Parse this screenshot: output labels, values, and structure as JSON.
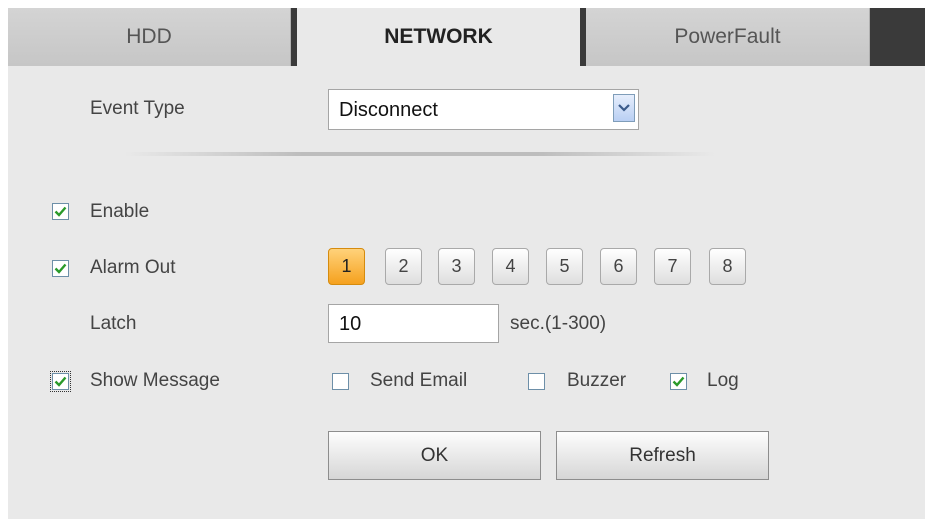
{
  "tabs": [
    {
      "label": "HDD",
      "active": false
    },
    {
      "label": "NETWORK",
      "active": true
    },
    {
      "label": "PowerFault",
      "active": false
    }
  ],
  "event_type": {
    "label": "Event Type",
    "value": "Disconnect"
  },
  "enable": {
    "label": "Enable",
    "checked": true
  },
  "alarm_out": {
    "label": "Alarm Out",
    "checked": true,
    "channels": [
      "1",
      "2",
      "3",
      "4",
      "5",
      "6",
      "7",
      "8"
    ],
    "selected": "1"
  },
  "latch": {
    "label": "Latch",
    "value": "10",
    "unit": "sec.(1-300)"
  },
  "show_message": {
    "label": "Show Message",
    "checked": true
  },
  "send_email": {
    "label": "Send Email",
    "checked": false
  },
  "buzzer": {
    "label": "Buzzer",
    "checked": false
  },
  "log": {
    "label": "Log",
    "checked": true
  },
  "buttons": {
    "ok": "OK",
    "refresh": "Refresh"
  },
  "colors": {
    "accent": "#f5a11e",
    "panel": "#e9e9e9",
    "tabbar": "#3a3a3a",
    "check": "#2a9a2a"
  }
}
